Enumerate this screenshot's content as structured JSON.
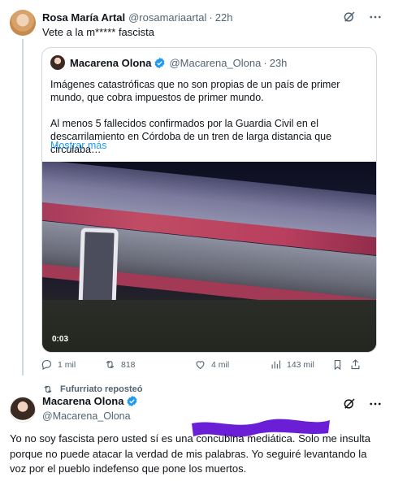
{
  "post1": {
    "author_name": "Rosa María Artal",
    "handle": "@rosamariaartal",
    "time": "22h",
    "text": "Vete a la m***** fascista"
  },
  "quoted": {
    "author_name": "Macarena Olona",
    "handle": "@Macarena_Olona",
    "time": "23h",
    "paragraph1": "Imágenes catastróficas que no son propias de un país de primer mundo, que cobra impuestos de primer mundo.",
    "paragraph2": "Al menos 5 fallecidos confirmados por la Guardia Civil en el descarrilamiento en Córdoba de un tren de larga distancia que circulaba…",
    "show_more": "Mostrar más",
    "video_time": "0:03"
  },
  "actions": {
    "replies": "1 mil",
    "reposts": "818",
    "likes": "4 mil",
    "views": "143 mil"
  },
  "repost_notice": "Fufurriato reposteó",
  "post2": {
    "author_name": "Macarena Olona",
    "handle": "@Macarena_Olona",
    "text": "Yo no soy fascista pero usted sí es una concubina mediática. Solo me insulta porque no puede atacar la verdad de mis palabras. Yo seguiré levantando la voz por el pueblo indefenso que pone los muertos."
  },
  "colors": {
    "accent": "#1d9bf0",
    "muted": "#536471",
    "border": "#cfd9de",
    "scribble": "#6a1fd6"
  },
  "icons": [
    "grok-icon",
    "more-icon",
    "verified-icon",
    "reply-icon",
    "repost-icon",
    "like-icon",
    "views-icon",
    "share-icon"
  ]
}
